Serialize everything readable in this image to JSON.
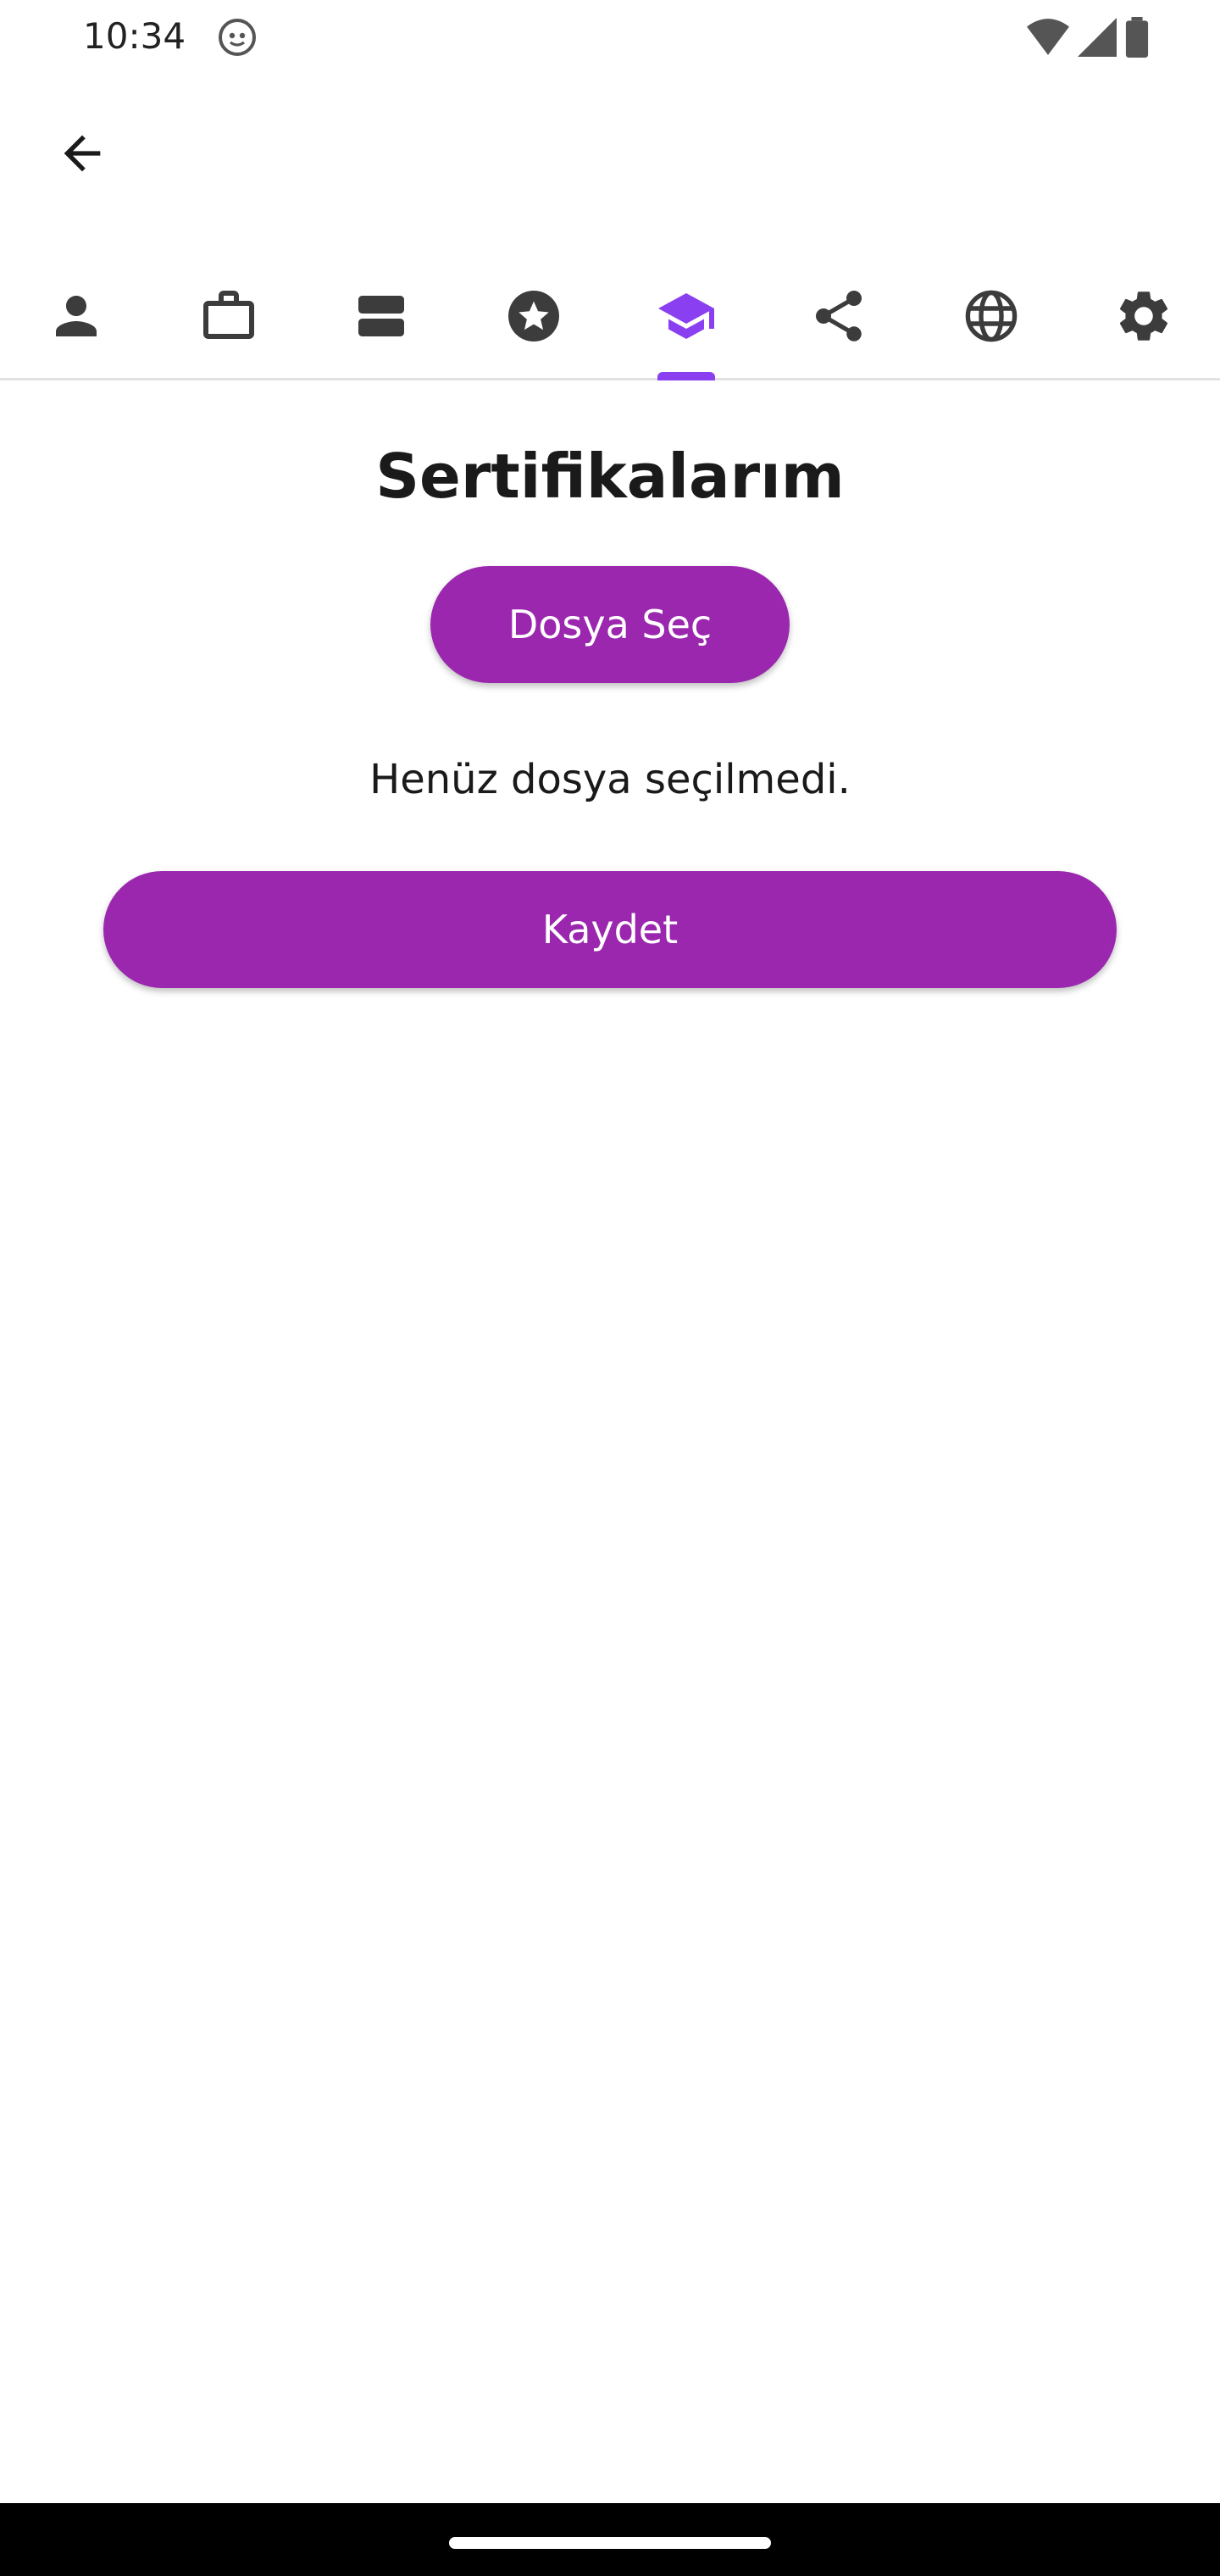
{
  "status_bar": {
    "time": "10:34"
  },
  "tabs": [
    {
      "icon": "person-icon",
      "active": false
    },
    {
      "icon": "briefcase-icon",
      "active": false
    },
    {
      "icon": "list-view-icon",
      "active": false
    },
    {
      "icon": "star-badge-icon",
      "active": false
    },
    {
      "icon": "school-icon",
      "active": true
    },
    {
      "icon": "share-icon",
      "active": false
    },
    {
      "icon": "globe-icon",
      "active": false
    },
    {
      "icon": "settings-icon",
      "active": false
    }
  ],
  "content": {
    "title": "Sertifikalarım",
    "choose_file_label": "Dosya Seç",
    "file_status": "Henüz dosya seçilmedi.",
    "save_label": "Kaydet"
  },
  "colors": {
    "primary": "#9b27af",
    "tab_indicator": "#8a3ff0",
    "icon_active": "#8a3ff0",
    "icon_inactive": "#3c3c3c"
  }
}
